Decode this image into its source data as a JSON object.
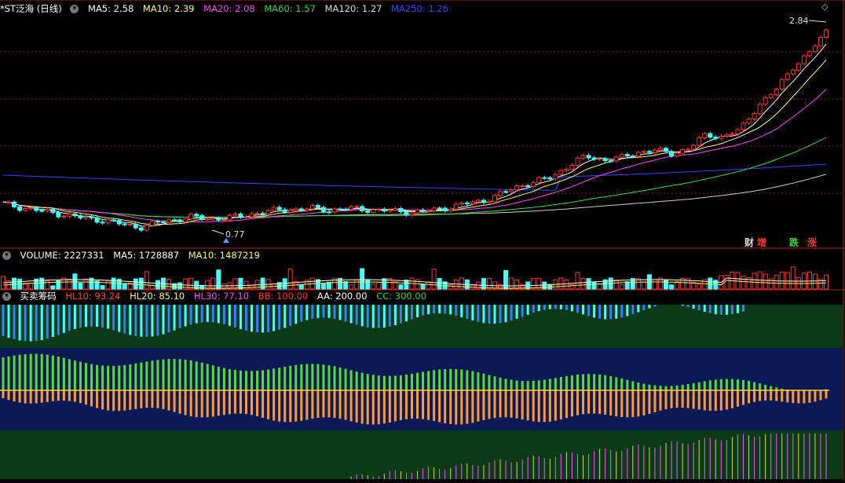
{
  "panel1": {
    "title": "*ST泛海 (日线)",
    "ma": [
      {
        "label": "MA5: 2.58",
        "color": "#ffffff"
      },
      {
        "label": "MA10: 2.39",
        "color": "#ffff55"
      },
      {
        "label": "MA20: 2.08",
        "color": "#ff44ff"
      },
      {
        "label": "MA60: 1.57",
        "color": "#33dd33"
      },
      {
        "label": "MA120: 1.27",
        "color": "#dddddd"
      },
      {
        "label": "MA250: 1.26",
        "color": "#3344ff"
      }
    ],
    "high_label": "2.84",
    "low_label": "0.77",
    "tags": [
      {
        "text": "财",
        "color": "#4488ff"
      },
      {
        "text": "增",
        "color": "#ff3333"
      },
      {
        "text": "跌",
        "color": "#33dd33"
      },
      {
        "text": "涨",
        "color": "#ff3333"
      }
    ]
  },
  "panel2": {
    "title": "VOLUME: 2227331",
    "ma": [
      {
        "label": "MA5: 1728887",
        "color": "#ffffff"
      },
      {
        "label": "MA10: 1487219",
        "color": "#ffff55"
      }
    ]
  },
  "panel3": {
    "title": "买卖筹码",
    "items": [
      {
        "label": "HL10: 93.24",
        "color": "#ff4444"
      },
      {
        "label": "HL20: 85.10",
        "color": "#ffff55"
      },
      {
        "label": "HL30: 77.10",
        "color": "#ff44ff"
      },
      {
        "label": "BB: 100.00",
        "color": "#ff3333"
      },
      {
        "label": "AA: 200.00",
        "color": "#ffffff"
      },
      {
        "label": "CC: 300.00",
        "color": "#33dd33"
      }
    ]
  },
  "chart_data": {
    "type": "candlestick",
    "close_start": 1.02,
    "close_trend": [
      1.02,
      0.98,
      0.95,
      0.92,
      0.89,
      0.86,
      0.84,
      0.8,
      0.77,
      0.82,
      0.85,
      0.88,
      0.86,
      0.87,
      0.89,
      0.93,
      0.95,
      0.96,
      0.97,
      0.95,
      0.97,
      0.96,
      0.95,
      0.94,
      0.93,
      0.95,
      0.98,
      1.02,
      1.05,
      1.12,
      1.2,
      1.25,
      1.3,
      1.42,
      1.52,
      1.48,
      1.5,
      1.56,
      1.58,
      1.55,
      1.6,
      1.75,
      1.72,
      1.8,
      2.05,
      2.2,
      2.45,
      2.6,
      2.84
    ],
    "volume_units": "shares",
    "last_volume": 2227331,
    "high": 2.84,
    "low": 0.77
  }
}
